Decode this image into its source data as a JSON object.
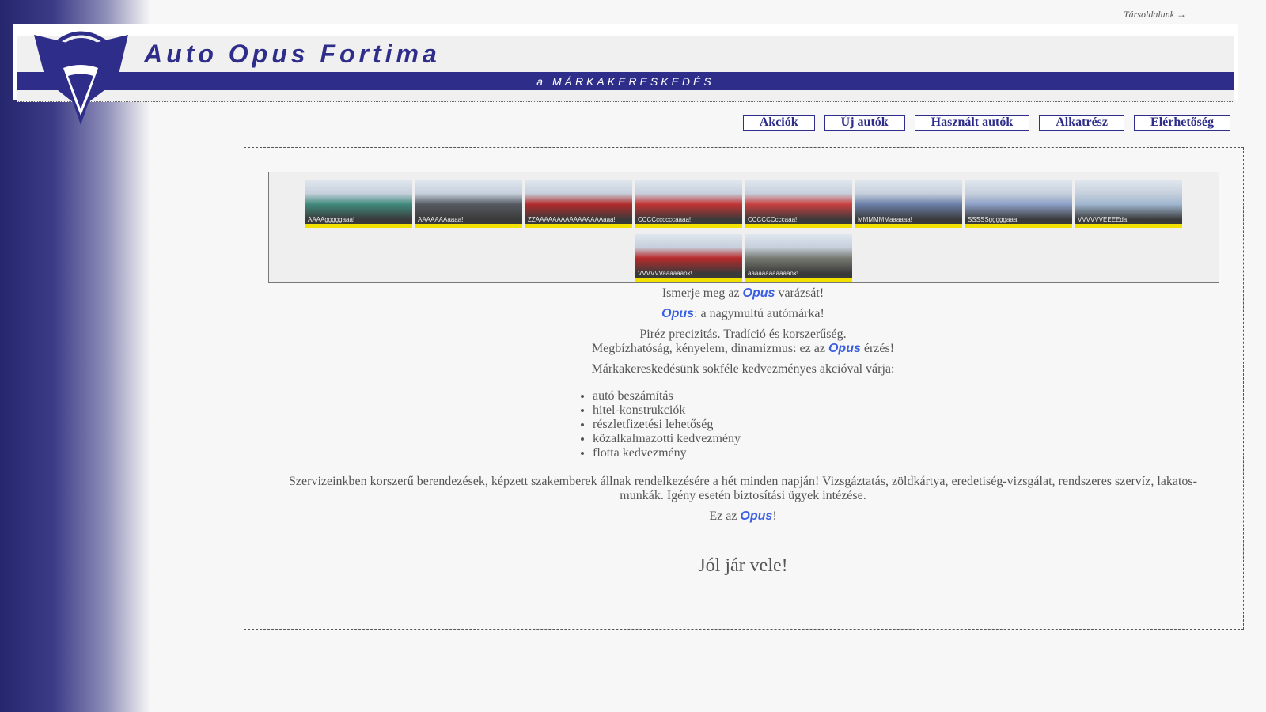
{
  "top_link": "Társoldalunk →",
  "header": {
    "title": "Auto Opus Fortima",
    "tagline": "a MÁRKAKERESKEDÉS"
  },
  "nav": [
    {
      "label": "Akciók"
    },
    {
      "label": "Új autók"
    },
    {
      "label": "Használt autók"
    },
    {
      "label": "Alkatrész"
    },
    {
      "label": "Elérhetőség"
    }
  ],
  "gallery": {
    "row1": [
      {
        "label": "AAAAgggggaaa!",
        "color": "#3f8a7c"
      },
      {
        "label": "AAAAAAAaaaa!",
        "color": "#555a60"
      },
      {
        "label": "ZZAAAAAAAAAAAAAAAAaaa!",
        "color": "#b22b2b"
      },
      {
        "label": "CCCCccccccaaaa!",
        "color": "#c23333"
      },
      {
        "label": "CCCCCCcccaaa!",
        "color": "#c94040"
      },
      {
        "label": "MMMMMMaaaaaa!",
        "color": "#6a7fa8"
      },
      {
        "label": "SSSSSgggggaaa!",
        "color": "#8ea0c8"
      },
      {
        "label": "VVVVVVEEEEda!",
        "color": "#9fb6cf"
      }
    ],
    "row2": [
      {
        "label": "VVVVVVaaaaaaok!",
        "color": "#b82a2a"
      },
      {
        "label": "aaaaaaaaaaaaok!",
        "color": "#777a72"
      }
    ]
  },
  "content": {
    "line1_pre": "Ismerje meg az ",
    "brand": "Opus",
    "line1_post": " varázsát!",
    "line2_post": ": a nagymultú autómárka!",
    "line3": "Piréz precizitás. Tradíció és korszerűség.",
    "line4_pre": "Megbízhatóság, kényelem, dinamizmus: ez az ",
    "line4_post": " érzés!",
    "line5": "Márkakereskedésünk sokféle kedvezményes akcióval várja:",
    "benefits": [
      "autó beszámítás",
      "hitel-konstrukciók",
      "részletfizetési lehetőség",
      "közalkalmazotti kedvezmény",
      "flotta kedvezmény"
    ],
    "service": "Szervizeinkben korszerű berendezések, képzett szakemberek állnak rendelkezésére a hét minden napján! Vizsgáztatás, zöldkártya, eredetiség-vizsgálat, rendszeres szervíz, lakatos-munkák. Igény esetén biztosítási ügyek intézése.",
    "closing_pre": "Ez az ",
    "closing_post": "!",
    "motto": "Jól jár vele!"
  },
  "colors": {
    "brand_navy": "#2e2e8a",
    "brand_blue": "#3a5fe0",
    "thumb_stripe": "#f2e000"
  }
}
